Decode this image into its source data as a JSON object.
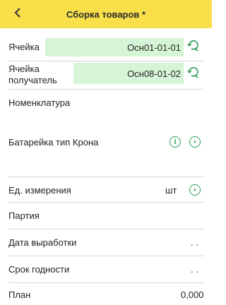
{
  "header": {
    "title": "Сборка товаров *"
  },
  "fields": {
    "cell": {
      "label": "Ячейка",
      "value": "Осн01-01-01"
    },
    "target_cell": {
      "label": "Ячейка получатель",
      "value": "Осн08-01-02"
    },
    "nomenclature": {
      "label": "Номенклатура",
      "value": "Батарейка тип Крона"
    },
    "unit": {
      "label": "Ед. измерения",
      "value": "шт"
    },
    "batch": {
      "label": "Партия"
    },
    "production_date": {
      "label": "Дата выработки",
      "value": ". ."
    },
    "expiry": {
      "label": "Срок годности",
      "value": ". ."
    },
    "plan": {
      "label": "План",
      "value": "0,000"
    }
  },
  "colors": {
    "header_bg": "#f9e04b",
    "field_bg": "#d6f5d6",
    "accent": "#2e9b55"
  }
}
